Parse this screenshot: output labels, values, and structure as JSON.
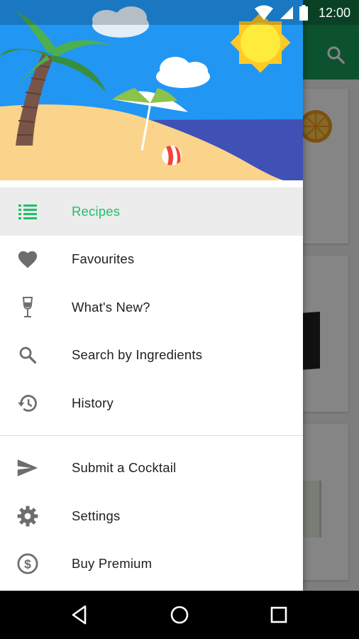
{
  "status_bar": {
    "time": "12:00"
  },
  "drawer": {
    "menu_primary": [
      {
        "label": "Recipes",
        "icon": "list-icon",
        "active": true
      },
      {
        "label": "Favourites",
        "icon": "heart-icon",
        "active": false
      },
      {
        "label": "What's New?",
        "icon": "wine-glass-icon",
        "active": false
      },
      {
        "label": "Search by Ingredients",
        "icon": "search-icon",
        "active": false
      },
      {
        "label": "History",
        "icon": "history-icon",
        "active": false
      }
    ],
    "menu_secondary": [
      {
        "label": "Submit a Cocktail",
        "icon": "send-icon"
      },
      {
        "label": "Settings",
        "icon": "gear-icon"
      },
      {
        "label": "Buy Premium",
        "icon": "dollar-icon"
      }
    ]
  },
  "colors": {
    "accent": "#1fbf6b",
    "toolbar": "#1a9e5a",
    "header_sky": "#2196f3"
  }
}
